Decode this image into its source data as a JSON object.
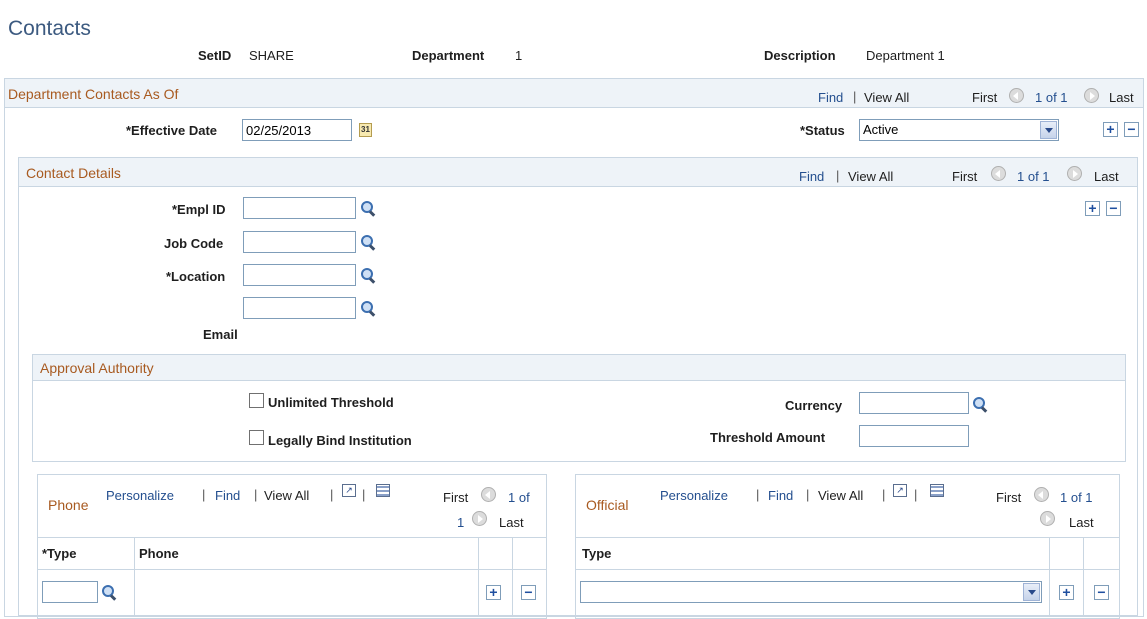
{
  "page": {
    "title": "Contacts"
  },
  "header": {
    "setid_label": "SetID",
    "setid_value": "SHARE",
    "department_label": "Department",
    "department_value": "1",
    "description_label": "Description",
    "description_value": "Department 1"
  },
  "dept_contacts": {
    "title": "Department Contacts As Of",
    "find": "Find",
    "view_all": "View All",
    "first": "First",
    "of": "1 of 1",
    "last": "Last",
    "effective_date_label": "*Effective Date",
    "effective_date_value": "02/25/2013",
    "status_label": "*Status",
    "status_value": "Active"
  },
  "contact_details": {
    "title": "Contact Details",
    "find": "Find",
    "view_all": "View All",
    "first": "First",
    "of": "1 of 1",
    "last": "Last",
    "empl_id_label": "*Empl ID",
    "job_code_label": "Job Code",
    "location_label": "*Location",
    "email_label": "Email"
  },
  "approval": {
    "title": "Approval Authority",
    "unlimited_label": "Unlimited Threshold",
    "legally_label": "Legally Bind Institution",
    "currency_label": "Currency",
    "threshold_label": "Threshold Amount"
  },
  "phone_grid": {
    "title": "Phone",
    "personalize": "Personalize",
    "find": "Find",
    "view_all": "View All",
    "first": "First",
    "of_line1": "1 of",
    "of_line2": "1",
    "last": "Last",
    "col_type": "*Type",
    "col_phone": "Phone"
  },
  "official_grid": {
    "title": "Official",
    "personalize": "Personalize",
    "find": "Find",
    "view_all": "View All",
    "first": "First",
    "of": "1 of 1",
    "last": "Last",
    "col_type": "Type"
  },
  "colors": {
    "title": "#3c5a80",
    "section_header": "#a85a20",
    "link": "#244f8f"
  }
}
